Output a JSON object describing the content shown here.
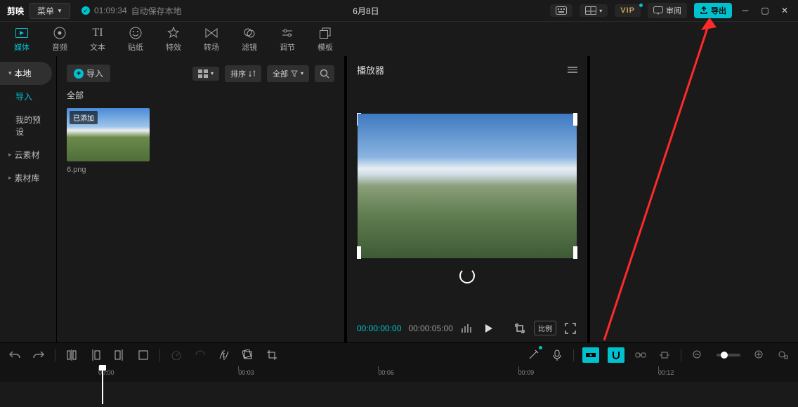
{
  "titlebar": {
    "app": "剪映",
    "menu": "菜单",
    "saved_time": "01:09:34",
    "saved_label": "自动保存本地",
    "doc_title": "6月8日",
    "vip": "VIP",
    "review": "审阅",
    "export": "导出"
  },
  "tabs": [
    {
      "id": "media",
      "label": "媒体"
    },
    {
      "id": "audio",
      "label": "音频"
    },
    {
      "id": "text",
      "label": "文本"
    },
    {
      "id": "sticker",
      "label": "贴纸"
    },
    {
      "id": "effect",
      "label": "特效"
    },
    {
      "id": "transition",
      "label": "转场"
    },
    {
      "id": "filter",
      "label": "滤镜"
    },
    {
      "id": "adjust",
      "label": "调节"
    },
    {
      "id": "template",
      "label": "模板"
    }
  ],
  "sidebar": [
    {
      "id": "local",
      "label": "本地",
      "chev": true,
      "active": true
    },
    {
      "id": "import",
      "label": "导入"
    },
    {
      "id": "preset",
      "label": "我的预设"
    },
    {
      "id": "cloud",
      "label": "云素材",
      "chev": true
    },
    {
      "id": "library",
      "label": "素材库",
      "chev": true
    }
  ],
  "media": {
    "import": "导入",
    "view_mode": "grid",
    "sort": "排序",
    "filter": "全部",
    "section": "全部",
    "item": {
      "tag": "已添加",
      "name": "6.png"
    }
  },
  "player": {
    "title": "播放器",
    "current": "00:00:00:00",
    "duration": "00:00:05:00",
    "ratio": "比例"
  },
  "ruler": [
    "00:00",
    "00:03",
    "00:06",
    "00:09",
    "00:12"
  ]
}
